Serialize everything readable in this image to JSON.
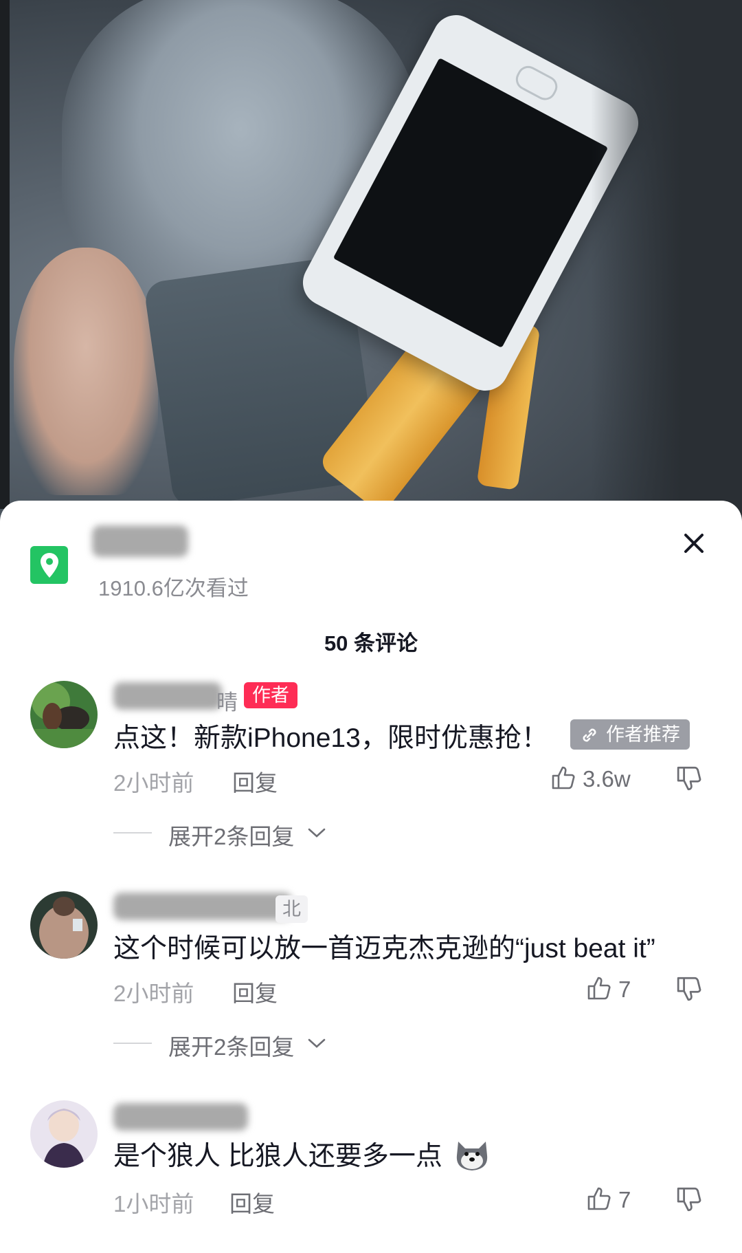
{
  "location": {
    "views": "1910.6亿次看过"
  },
  "comments_count": "50 条评论",
  "comments": [
    {
      "name_tail": "晴",
      "author_tag": "作者",
      "text": "点这！新款iPhone13，限时优惠抢！",
      "recommend_tag": "作者推荐",
      "time": "2小时前",
      "reply": "回复",
      "likes": "3.6w",
      "expand": "展开2条回复"
    },
    {
      "name_tail": "北",
      "text": "这个时候可以放一首迈克杰克逊的“just beat it”",
      "time": "2小时前",
      "reply": "回复",
      "likes": "7",
      "expand": "展开2条回复"
    },
    {
      "text": "是个狼人  比狼人还要多一点",
      "time": "1小时前",
      "reply": "回复",
      "likes": "7"
    }
  ],
  "colors": {
    "author_tag": "#fe2c55",
    "location_icon": "#23c463",
    "recommend_tag": "#9c9ea5"
  }
}
